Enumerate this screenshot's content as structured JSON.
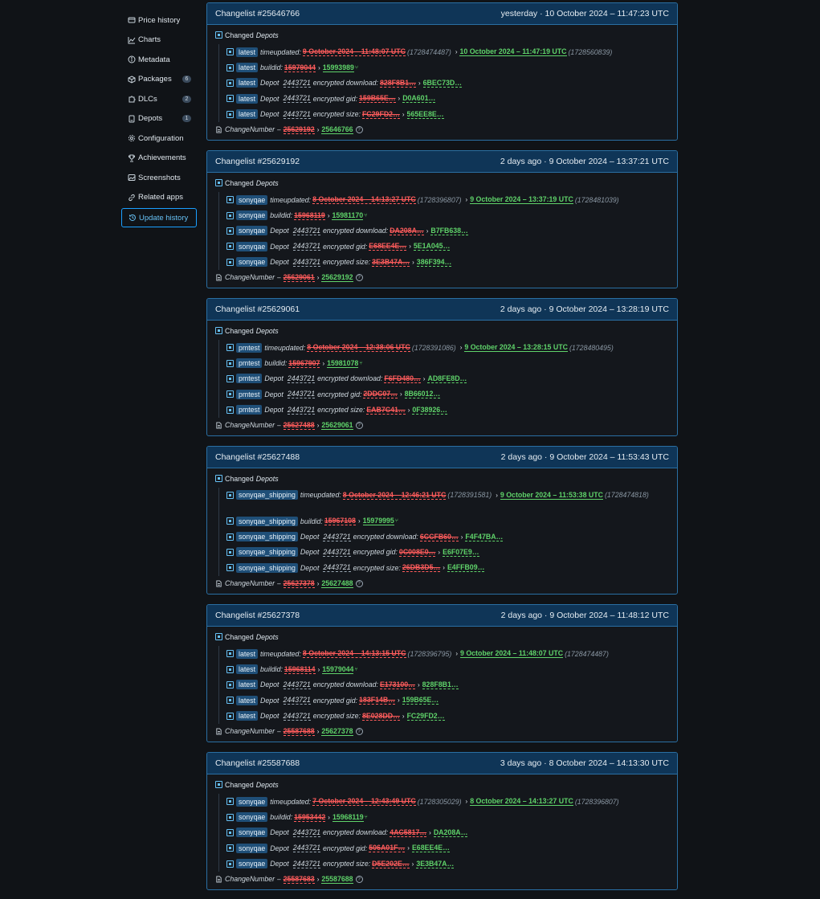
{
  "sidebar": {
    "items": [
      {
        "label": "Price history",
        "icon": "price-tag-icon"
      },
      {
        "label": "Charts",
        "icon": "chart-line-icon"
      },
      {
        "label": "Metadata",
        "icon": "info-icon"
      },
      {
        "label": "Packages",
        "icon": "package-icon",
        "count": "6"
      },
      {
        "label": "DLCs",
        "icon": "puzzle-icon",
        "count": "2"
      },
      {
        "label": "Depots",
        "icon": "server-icon",
        "count": "1"
      },
      {
        "label": "Configuration",
        "icon": "gear-icon"
      },
      {
        "label": "Achievements",
        "icon": "trophy-icon"
      },
      {
        "label": "Screenshots",
        "icon": "image-icon"
      },
      {
        "label": "Related apps",
        "icon": "link-icon"
      },
      {
        "label": "Update history",
        "icon": "history-icon",
        "active": true
      }
    ]
  },
  "labels": {
    "changed_prefix": "Changed",
    "changed_depots": "Depots",
    "timeupdated": "timeupdated:",
    "buildid": "buildid:",
    "depot": "Depot",
    "enc_download": "encrypted download:",
    "enc_gid": "encrypted gid:",
    "enc_size": "encrypted size:",
    "changenumber": "ChangeNumber",
    "dash": "–",
    "question": "?"
  },
  "changelists": [
    {
      "title": "Changelist #25646766",
      "time": "yesterday · 10 October 2024 – 11:47:23 UTC",
      "branch": "latest",
      "time_old": "9 October 2024 – 11:48:07 UTC",
      "time_old_ts": "(1728474487)",
      "time_new": "10 October 2024 – 11:47:19 UTC",
      "time_new_ts": "(1728560839)",
      "build_old": "15979044",
      "build_new": "15993989",
      "depot_id": "2443721",
      "dl_old": "828F8B1…",
      "dl_new": "6BEC73D…",
      "gid_old": "159B65E…",
      "gid_new": "D0A601…",
      "size_old": "FC29FD2…",
      "size_new": "565EE8E…",
      "cn_old": "25629192",
      "cn_new": "25646766"
    },
    {
      "title": "Changelist #25629192",
      "time": "2 days ago · 9 October 2024 – 13:37:21 UTC",
      "branch": "sonyqae",
      "time_old": "8 October 2024 – 14:13:27 UTC",
      "time_old_ts": "(1728396807)",
      "time_new": "9 October 2024 – 13:37:19 UTC",
      "time_new_ts": "(1728481039)",
      "build_old": "15968119",
      "build_new": "15981170",
      "depot_id": "2443721",
      "dl_old": "DA208A…",
      "dl_new": "B7FB638…",
      "gid_old": "E68EE4E…",
      "gid_new": "5E1A045…",
      "size_old": "3E3B47A…",
      "size_new": "386F394…",
      "cn_old": "25629061",
      "cn_new": "25629192"
    },
    {
      "title": "Changelist #25629061",
      "time": "2 days ago · 9 October 2024 – 13:28:19 UTC",
      "branch": "pmtest",
      "time_old": "8 October 2024 – 12:38:06 UTC",
      "time_old_ts": "(1728391086)",
      "time_new": "9 October 2024 – 13:28:15 UTC",
      "time_new_ts": "(1728480495)",
      "build_old": "15967907",
      "build_new": "15981078",
      "depot_id": "2443721",
      "dl_old": "F6FD480…",
      "dl_new": "AD8FE8D…",
      "gid_old": "2DDC07…",
      "gid_new": "8B66012…",
      "size_old": "EAB7C41…",
      "size_new": "0F38926…",
      "cn_old": "25627488",
      "cn_new": "25629061"
    },
    {
      "title": "Changelist #25627488",
      "time": "2 days ago · 9 October 2024 – 11:53:43 UTC",
      "branch": "sonyqae_shipping",
      "time_old": "8 October 2024 – 12:46:21 UTC",
      "time_old_ts": "(1728391581)",
      "time_new": "9 October 2024 – 11:53:38 UTC",
      "time_new_ts": "(1728474818)",
      "build_old": "15967108",
      "build_new": "15979995",
      "depot_id": "2443721",
      "dl_old": "6CCFB60…",
      "dl_new": "F4F47BA…",
      "gid_old": "0C008E0…",
      "gid_new": "E6F07E9…",
      "size_old": "26DB3D5…",
      "size_new": "E4FFB09…",
      "cn_old": "25627378",
      "cn_new": "25627488"
    },
    {
      "title": "Changelist #25627378",
      "time": "2 days ago · 9 October 2024 – 11:48:12 UTC",
      "branch": "latest",
      "time_old": "8 October 2024 – 14:13:15 UTC",
      "time_old_ts": "(1728396795)",
      "time_new": "9 October 2024 – 11:48:07 UTC",
      "time_new_ts": "(1728474487)",
      "build_old": "15968114",
      "build_new": "15979044",
      "depot_id": "2443721",
      "dl_old": "E173100…",
      "dl_new": "828F8B1…",
      "gid_old": "183F14B…",
      "gid_new": "159B65E…",
      "size_old": "8E028DD…",
      "size_new": "FC29FD2…",
      "cn_old": "25587688",
      "cn_new": "25627378"
    },
    {
      "title": "Changelist #25587688",
      "time": "3 days ago · 8 October 2024 – 14:13:30 UTC",
      "branch": "sonyqae",
      "time_old": "7 October 2024 – 12:43:49 UTC",
      "time_old_ts": "(1728305029)",
      "time_new": "8 October 2024 – 14:13:27 UTC",
      "time_new_ts": "(1728396807)",
      "build_old": "15953442",
      "build_new": "15968119",
      "depot_id": "2443721",
      "dl_old": "4AC5817…",
      "dl_new": "DA208A…",
      "gid_old": "506A01F…",
      "gid_new": "E68EE4E…",
      "size_old": "D5E202E…",
      "size_new": "3E3B47A…",
      "cn_old": "25587683",
      "cn_new": "25587688"
    }
  ]
}
